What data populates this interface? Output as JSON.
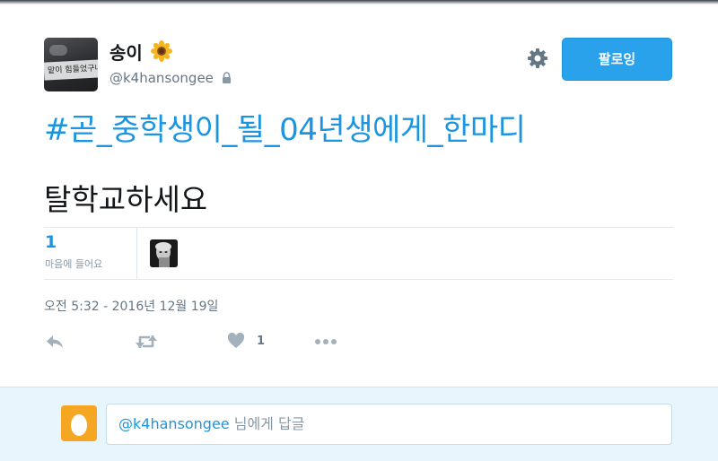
{
  "header": {
    "display_name": "송이",
    "handle": "@k4hansongee",
    "follow_label": "팔로잉",
    "avatar_sign_text": "맡이 힘들었구나"
  },
  "tweet": {
    "hashtag": "#곧_중학생이_될_04년생에게_한마디",
    "text": "탈학교하세요",
    "likes_count": "1",
    "likes_label": "마음에 들어요",
    "timestamp": "오전 5:32 - 2016년 12월 19일",
    "action_like_count": "1"
  },
  "reply": {
    "mention": "@k4hansongee",
    "placeholder": " 님에게 답글"
  },
  "colors": {
    "accent": "#1b95e0",
    "follow_button": "#2aa1eb",
    "muted": "#657786",
    "reply_panel": "#e8f5fd"
  },
  "icons": [
    "sunflower-icon",
    "lock-icon",
    "gear-icon",
    "reply-icon",
    "retweet-icon",
    "heart-icon",
    "more-icon"
  ]
}
